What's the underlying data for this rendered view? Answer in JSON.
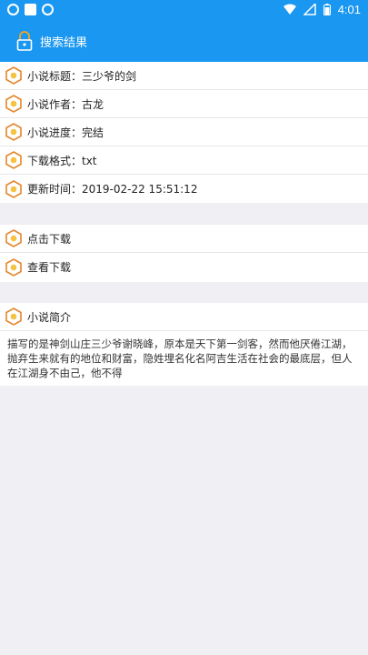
{
  "header": {
    "title": "搜索结果"
  },
  "status": {
    "time": "4:01"
  },
  "info": [
    {
      "label": "小说标题：三少爷的剑"
    },
    {
      "label": "小说作者：古龙"
    },
    {
      "label": "小说进度：完结"
    },
    {
      "label": "下载格式：txt"
    },
    {
      "label": "更新时间：2019-02-22 15:51:12"
    }
  ],
  "actions": [
    {
      "label": "点击下载"
    },
    {
      "label": "查看下载"
    }
  ],
  "intro": {
    "heading": "小说简介",
    "text": "描写的是神剑山庄三少爷谢晓峰，原本是天下第一剑客，然而他厌倦江湖，抛弃生来就有的地位和财富，隐姓埋名化名阿吉生活在社会的最底层，但人在江湖身不由己，他不得"
  },
  "colors": {
    "accent": "#1a97f0",
    "icon": "#e5862b"
  }
}
